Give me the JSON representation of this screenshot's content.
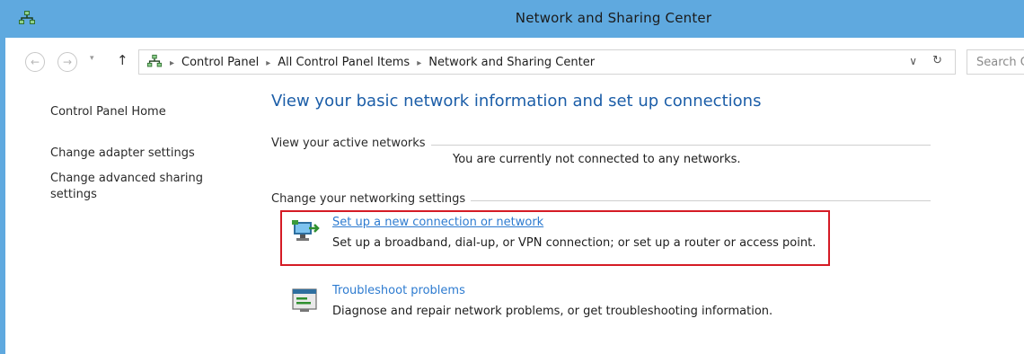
{
  "window": {
    "title": "Network and Sharing Center",
    "accent_color": "#5fa9df",
    "title_icon": "network-sharing-icon"
  },
  "navigation": {
    "back_icon": "back-arrow-icon",
    "forward_icon": "forward-arrow-icon",
    "recent_icon": "chevron-down-icon",
    "up_icon": "up-arrow-icon",
    "breadcrumbs": [
      "Control Panel",
      "All Control Panel Items",
      "Network and Sharing Center"
    ],
    "refresh_icon": "refresh-icon",
    "search_placeholder": "Search C"
  },
  "sidebar": {
    "items": [
      {
        "label": "Control Panel Home"
      },
      {
        "label": "Change adapter settings"
      },
      {
        "label": "Change advanced sharing settings"
      }
    ]
  },
  "main": {
    "title": "View your basic network information and set up connections",
    "active_networks": {
      "heading": "View your active networks",
      "status": "You are currently not connected to any networks."
    },
    "networking_settings": {
      "heading": "Change your networking settings",
      "tasks": [
        {
          "link": "Set up a new connection or network",
          "description": "Set up a broadband, dial-up, or VPN connection; or set up a router or access point.",
          "icon": "new-connection-icon",
          "highlighted": true,
          "highlight_color": "#d51b25"
        },
        {
          "link": "Troubleshoot problems",
          "description": "Diagnose and repair network problems, or get troubleshooting information.",
          "icon": "troubleshoot-icon",
          "highlighted": false
        }
      ]
    }
  }
}
